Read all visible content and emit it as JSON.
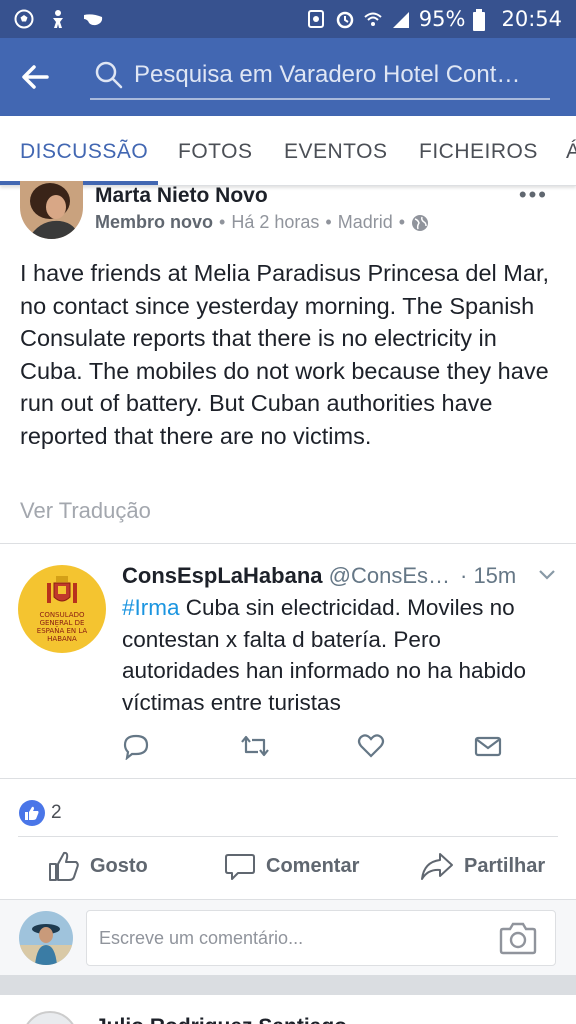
{
  "status_bar": {
    "battery": "95%",
    "time": "20:54"
  },
  "search": {
    "placeholder": "Pesquisa em Varadero Hotel Cont…"
  },
  "tabs": [
    {
      "label": "DISCUSSÃO"
    },
    {
      "label": "FOTOS"
    },
    {
      "label": "EVENTOS"
    },
    {
      "label": "FICHEIROS"
    },
    {
      "label": "Á"
    }
  ],
  "post": {
    "author": "Marta Nieto Novo",
    "badge": "Membro novo",
    "time": "Há 2 horas",
    "location": "Madrid",
    "separator": "•",
    "more": "•••",
    "body": "I have friends at Melia Paradisus Princesa del Mar, no contact since yesterday morning. The Spanish Consulate reports that there is no electricity in Cuba. The mobiles do not work because they have run out of battery. But Cuban authorities have reported that there are no victims.",
    "translate": "Ver Tradução"
  },
  "tweet": {
    "name": "ConsEspLaHabana",
    "handle": "@ConsEs…",
    "time": "· 15m",
    "hashtag": "#Irma",
    "text": " Cuba sin electricidad. Moviles no contestan x falta d batería. Pero autoridades han informado no ha habido víctimas entre turistas",
    "logo_text": "CONSULADO GENERAL DE ESPAÑA EN LA HABANA"
  },
  "reactions": {
    "count": "2"
  },
  "actions": {
    "like": "Gosto",
    "comment": "Comentar",
    "share": "Partilhar"
  },
  "composer": {
    "placeholder": "Escreve um comentário..."
  },
  "next_post": {
    "author": "Julio Rodriguez Santiago"
  },
  "colors": {
    "status_bar": "#37528f",
    "app_bar": "#4267b2",
    "accent": "#4267b2",
    "hashtag": "#1b95e0",
    "tweet_logo": "#f4c430"
  }
}
